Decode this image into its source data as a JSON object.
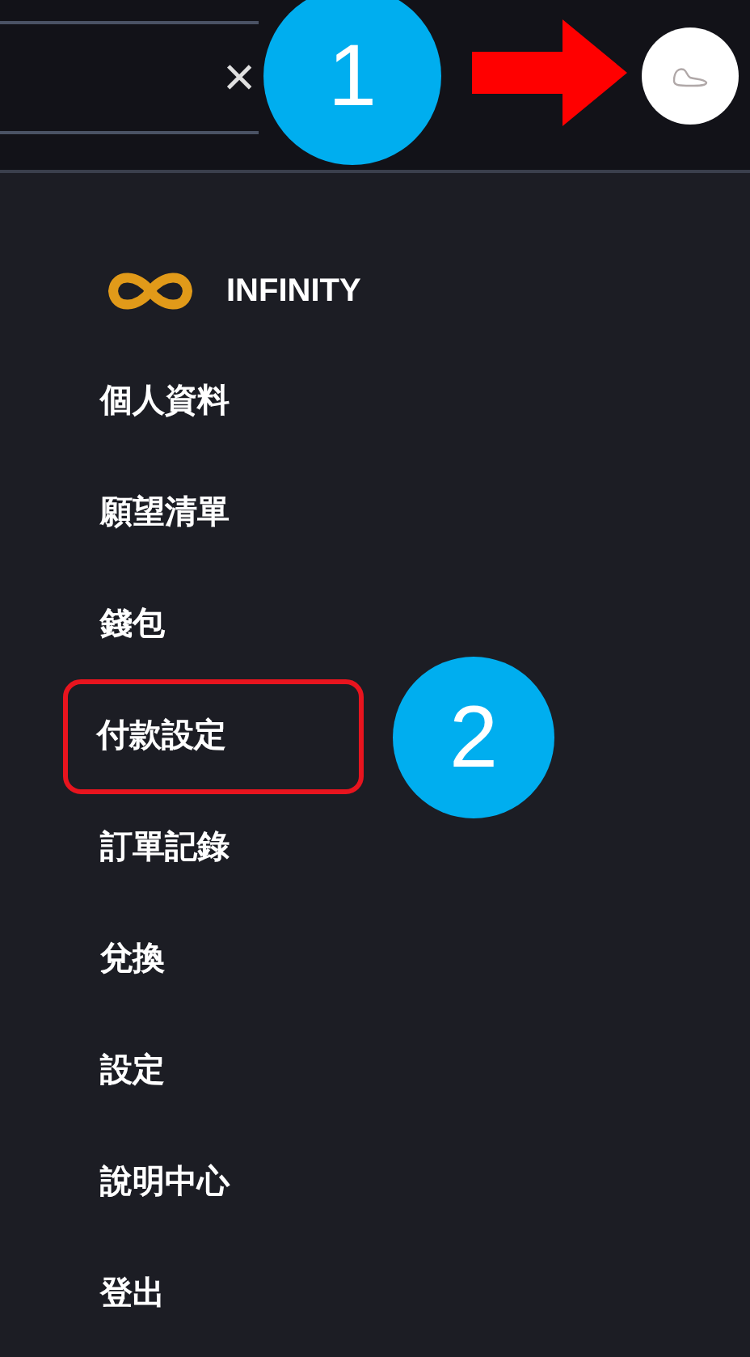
{
  "search": {
    "clear_icon": "×"
  },
  "menu": {
    "brand": "INFINITY",
    "items": [
      {
        "label": "個人資料",
        "highlighted": false
      },
      {
        "label": "願望清單",
        "highlighted": false
      },
      {
        "label": "錢包",
        "highlighted": false
      },
      {
        "label": "付款設定",
        "highlighted": true
      },
      {
        "label": "訂單記錄",
        "highlighted": false
      },
      {
        "label": "兌換",
        "highlighted": false
      },
      {
        "label": "設定",
        "highlighted": false
      },
      {
        "label": "說明中心",
        "highlighted": false
      },
      {
        "label": "登出",
        "highlighted": false
      }
    ]
  },
  "annotations": [
    {
      "label": "1"
    },
    {
      "label": "2"
    }
  ]
}
